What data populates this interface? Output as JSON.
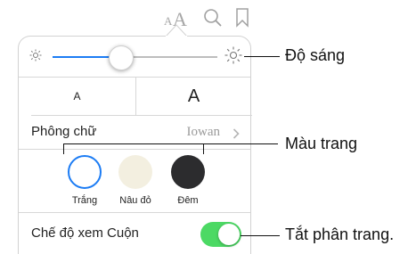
{
  "toolbar": {
    "font_icon": "font-size-icon",
    "search_icon": "search-icon",
    "bookmark_icon": "bookmark-icon"
  },
  "brightness": {
    "low_icon": "sun-small-icon",
    "high_icon": "sun-large-icon",
    "level": 0.41
  },
  "font_size": {
    "smaller_label": "A",
    "larger_label": "A"
  },
  "font_row": {
    "label": "Phông chữ",
    "value": "Iowan",
    "chevron": "chevron-right-icon"
  },
  "themes": [
    {
      "label": "Trắng",
      "color": "#ffffff",
      "selected": true
    },
    {
      "label": "Nâu đỏ",
      "color": "#f3efe0",
      "selected": false
    },
    {
      "label": "Đêm",
      "color": "#2c2c2e",
      "selected": false
    }
  ],
  "scroll_mode": {
    "label": "Chế độ xem Cuộn",
    "on": true
  },
  "callouts": {
    "brightness": "Độ sáng",
    "page_color": "Màu trang",
    "paging_off": "Tắt phân trang."
  },
  "colors": {
    "accent": "#1c7cf4",
    "toggle_on": "#4cd964",
    "separator": "#d7d7d7"
  }
}
